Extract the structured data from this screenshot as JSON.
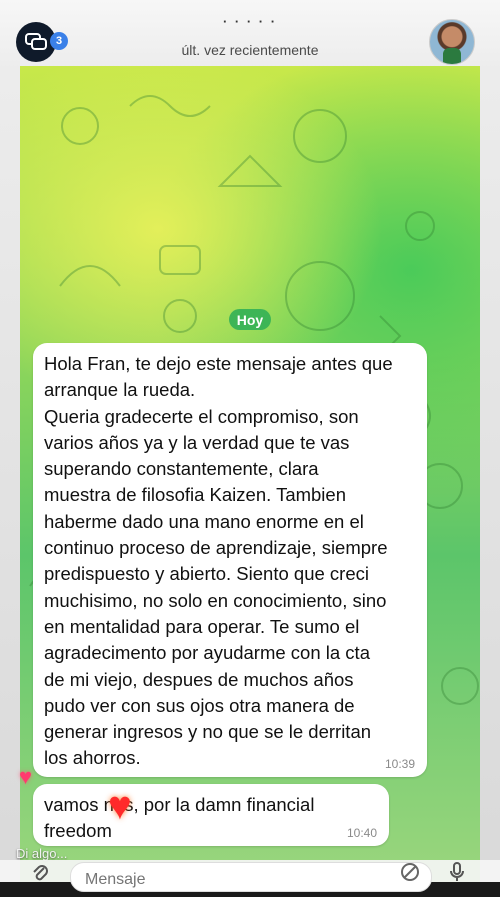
{
  "header": {
    "contact_name": "· · · · ·",
    "last_seen": "últ. vez recientemente",
    "unread_count": "3"
  },
  "chat": {
    "date_separator": "Hoy",
    "messages": [
      {
        "text": "Hola Fran, te dejo este mensaje antes que\narranque la rueda.\nQueria gradecerte el compromiso, son\nvarios años ya y la verdad que te vas\nsuperando constantemente, clara\nmuestra de filosofia Kaizen. Tambien\nhaberme dado una mano enorme en el\ncontinuo proceso de aprendizaje, siempre\npredispuesto y abierto. Siento que creci\nmuchisimo, no solo en conocimiento, sino\nen mentalidad para operar. Te sumo el\nagradecimento por ayudarme con la cta\nde mi viejo, despues de muchos años\npudo ver con sus ojos otra manera de\ngenerar ingresos y no que se le derritan\nlos ahorros.",
        "time": "10:39"
      },
      {
        "text": "vamos      nas, por la damn financial\nfreedom",
        "time": "10:40"
      }
    ],
    "reaction": "♥",
    "sticker": "♥"
  },
  "composer": {
    "typing_status": "Di algo...",
    "placeholder": "Mensaje"
  },
  "icons": {
    "app": "chat-bubbles-icon",
    "attach": "paperclip-icon",
    "sticker": "sticker-icon",
    "mic": "microphone-icon"
  }
}
